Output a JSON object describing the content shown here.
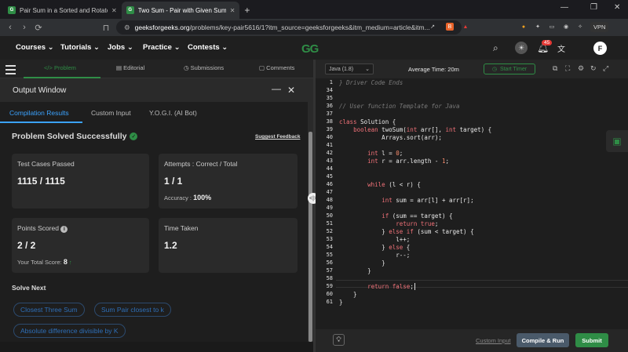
{
  "browser": {
    "tabs": [
      {
        "title": "Pair Sum in a Sorted and Rotated A",
        "active": false
      },
      {
        "title": "Two Sum - Pair with Given Sum",
        "active": true
      }
    ],
    "new_tab_icon": "+",
    "url_host": "geeksforgeeks.org",
    "url_rest": "/problems/key-pair5616/1?itm_source=geeksforgeeks&itm_medium=article&itm...",
    "vpn_label": "VPN"
  },
  "site": {
    "nav": [
      "Courses",
      "Tutorials",
      "Jobs",
      "Practice",
      "Contests"
    ],
    "logo": "GG",
    "notification_count": "45",
    "avatar_letter": "F",
    "accent": "#2f8d46"
  },
  "problem_tabs": [
    {
      "label": "Problem",
      "icon": "code-icon",
      "active": true
    },
    {
      "label": "Editorial",
      "icon": "document-icon",
      "active": false
    },
    {
      "label": "Submissions",
      "icon": "clock-icon",
      "active": false
    },
    {
      "label": "Comments",
      "icon": "comment-icon",
      "active": false
    }
  ],
  "output": {
    "title": "Output Window",
    "tabs": [
      "Compilation Results",
      "Custom Input",
      "Y.O.G.I. (AI Bot)"
    ],
    "status": "Problem Solved Successfully",
    "feedback": "Suggest Feedback",
    "test_cases_label": "Test Cases Passed",
    "test_cases_value": "1115 / 1115",
    "attempts_label": "Attempts : Correct / Total",
    "attempts_value": "1 / 1",
    "accuracy_label": "Accuracy :",
    "accuracy_value": "100%",
    "points_label": "Points Scored",
    "points_value": "2 / 2",
    "total_score_label": "Your Total Score:",
    "total_score_value": "8",
    "time_label": "Time Taken",
    "time_value": "1.2",
    "solve_next": "Solve Next",
    "suggestions": [
      "Closest Three Sum",
      "Sum Pair closest to k",
      "Absolute difference divisible by K"
    ]
  },
  "editor": {
    "language": "Java (1.8)",
    "avg_time": "Average Time: 20m",
    "start_timer": "Start Timer",
    "line_numbers": [
      "1",
      "34",
      "35",
      "36",
      "37",
      "38",
      "39",
      "40",
      "41",
      "42",
      "43",
      "44",
      "45",
      "46",
      "47",
      "48",
      "49",
      "50",
      "51",
      "52",
      "53",
      "54",
      "55",
      "56",
      "57",
      "58",
      "59",
      "60",
      "61"
    ],
    "lines": [
      "} Driver Code Ends",
      "",
      "",
      "// User function Template for Java",
      "",
      "class Solution {",
      "    boolean twoSum(int arr[], int target) {",
      "            Arrays.sort(arr);",
      "",
      "        int l = 0;",
      "        int r = arr.length - 1;",
      "",
      "",
      "        while (l < r) {",
      "",
      "            int sum = arr[l] + arr[r];",
      "",
      "            if (sum == target) {",
      "                return true;",
      "            } else if (sum < target) {",
      "                l++;",
      "            } else {",
      "                r--;",
      "            }",
      "        }",
      "",
      "        return false;",
      "    }",
      "}"
    ],
    "custom_input": "Custom Input",
    "compile_run": "Compile & Run",
    "submit": "Submit"
  }
}
